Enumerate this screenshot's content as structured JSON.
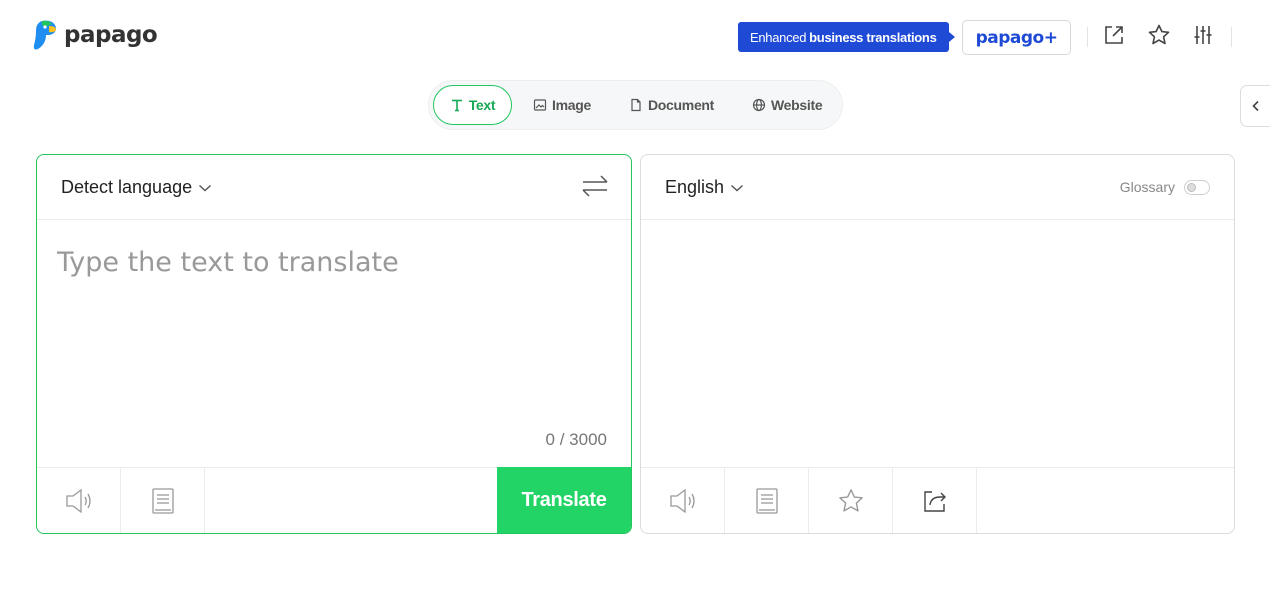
{
  "header": {
    "logo_text": "papago",
    "promo_prefix": "Enhanced",
    "promo_bold": "business translations",
    "plus_label": "papago+",
    "icons": [
      "open-new-window-icon",
      "star-icon",
      "settings-sliders-icon"
    ]
  },
  "tabs": [
    {
      "label": "Text",
      "icon": "text-icon",
      "active": true
    },
    {
      "label": "Image",
      "icon": "image-icon",
      "active": false
    },
    {
      "label": "Document",
      "icon": "document-icon",
      "active": false
    },
    {
      "label": "Website",
      "icon": "globe-icon",
      "active": false
    }
  ],
  "source": {
    "language": "Detect language",
    "placeholder": "Type the text to translate",
    "counter": "0 / 3000",
    "translate_label": "Translate"
  },
  "target": {
    "language": "English",
    "glossary_label": "Glossary",
    "glossary_enabled": false
  },
  "colors": {
    "accent_green": "#21d465",
    "brand_blue": "#1f4ad6"
  }
}
